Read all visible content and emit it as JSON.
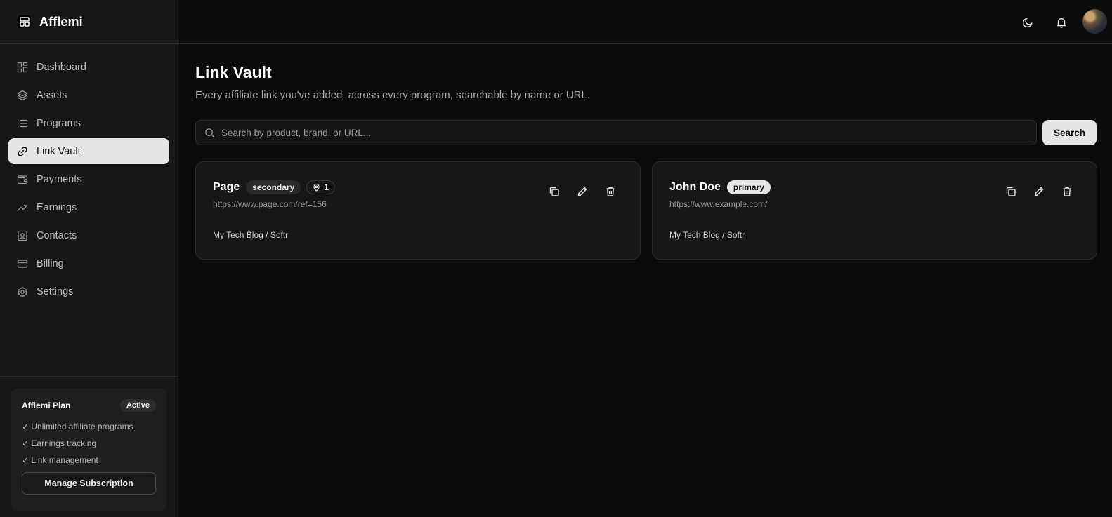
{
  "brand": {
    "name": "Afflemi"
  },
  "nav": {
    "items": [
      {
        "label": "Dashboard",
        "icon": "dashboard-icon"
      },
      {
        "label": "Assets",
        "icon": "layers-icon"
      },
      {
        "label": "Programs",
        "icon": "list-icon"
      },
      {
        "label": "Link Vault",
        "icon": "link-icon",
        "active": true
      },
      {
        "label": "Payments",
        "icon": "wallet-icon"
      },
      {
        "label": "Earnings",
        "icon": "trending-up-icon"
      },
      {
        "label": "Contacts",
        "icon": "contact-icon"
      },
      {
        "label": "Billing",
        "icon": "credit-card-icon"
      },
      {
        "label": "Settings",
        "icon": "gear-icon"
      }
    ]
  },
  "plan": {
    "title": "Afflemi Plan",
    "status": "Active",
    "features": [
      "✓ Unlimited affiliate programs",
      "✓ Earnings tracking",
      "✓ Link management"
    ],
    "button_label": "Manage Subscription"
  },
  "topbar": {
    "icons": [
      "moon-icon",
      "bell-icon",
      "avatar"
    ]
  },
  "page": {
    "title": "Link Vault",
    "subtitle": "Every affiliate link you've added, across every program, searchable by name or URL."
  },
  "search": {
    "placeholder": "Search by product, brand, or URL...",
    "value": "",
    "button_label": "Search"
  },
  "links": [
    {
      "name": "Page",
      "tag": "secondary",
      "count": "1",
      "url": "https://www.page.com/ref=156",
      "meta": "My Tech Blog / Softr"
    },
    {
      "name": "John Doe",
      "tag": "primary",
      "url": "https://www.example.com/",
      "meta": "My Tech Blog / Softr"
    }
  ],
  "colors": {
    "background": "#0b0b0b",
    "sidebar": "#171717",
    "accent": "#e6e6e6"
  }
}
